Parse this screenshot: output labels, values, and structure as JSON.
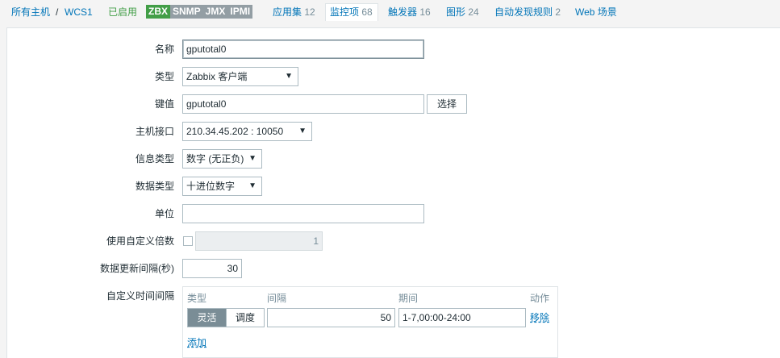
{
  "nav": {
    "all_hosts": "所有主机",
    "separator": "/",
    "host": "WCS1",
    "status": "已启用",
    "badges": [
      "ZBX",
      "SNMP",
      "JMX",
      "IPMI"
    ],
    "applications": {
      "label": "应用集",
      "count": "12"
    },
    "items": {
      "label": "监控项",
      "count": "68"
    },
    "triggers": {
      "label": "触发器",
      "count": "16"
    },
    "graphs": {
      "label": "图形",
      "count": "24"
    },
    "discovery": {
      "label": "自动发现规则",
      "count": "2"
    },
    "web": {
      "label": "Web 场景"
    }
  },
  "form": {
    "name": {
      "label": "名称",
      "value": "gputotal0"
    },
    "type": {
      "label": "类型",
      "value": "Zabbix 客户端"
    },
    "key": {
      "label": "键值",
      "value": "gputotal0",
      "select_button": "选择"
    },
    "interface": {
      "label": "主机接口",
      "value": "210.34.45.202 : 10050"
    },
    "info_type": {
      "label": "信息类型",
      "value": "数字 (无正负)"
    },
    "data_type": {
      "label": "数据类型",
      "value": "十进位数字"
    },
    "units": {
      "label": "单位",
      "value": ""
    },
    "multiplier": {
      "label": "使用自定义倍数",
      "checked": false,
      "value": "1"
    },
    "update_interval": {
      "label": "数据更新间隔(秒)",
      "value": "30"
    },
    "custom_intervals": {
      "label": "自定义时间间隔",
      "headers": {
        "type": "类型",
        "interval": "间隔",
        "period": "期间",
        "action": "动作"
      },
      "rows": [
        {
          "type_options": [
            "灵活",
            "调度"
          ],
          "selected": "灵活",
          "interval": "50",
          "period": "1-7,00:00-24:00",
          "action": "移除"
        }
      ],
      "add": "添加"
    }
  }
}
